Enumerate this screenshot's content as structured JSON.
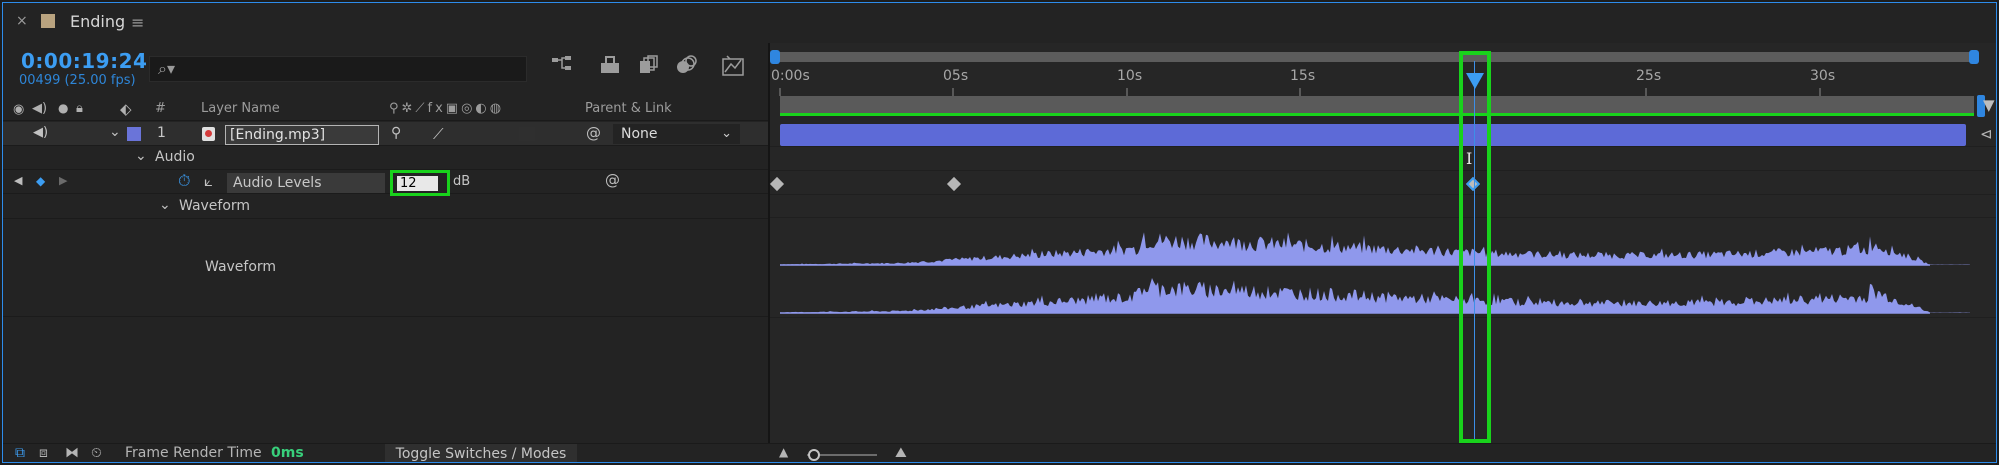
{
  "tab": {
    "close": "×",
    "title": "Ending",
    "menu": "≡"
  },
  "time": {
    "timecode": "0:00:19:24",
    "frames": "00499 (25.00 fps)"
  },
  "search": {
    "placeholder": "",
    "icon": "search-icon"
  },
  "header": {
    "layer_name": "Layer Name",
    "number": "#",
    "parent_link": "Parent & Link"
  },
  "layer": {
    "number": "1",
    "name": "[Ending.mp3]",
    "parent": "None",
    "color": "#6a74d9"
  },
  "audio_group": {
    "label": "Audio"
  },
  "audio_levels": {
    "label": "Audio Levels",
    "value": "12",
    "unit": "dB"
  },
  "waveform_group": {
    "label": "Waveform"
  },
  "waveform_row": {
    "label": "Waveform"
  },
  "ruler": {
    "labels": [
      "0:00s",
      "05s",
      "10s",
      "15s",
      "25s",
      "30s"
    ]
  },
  "footer": {
    "render_label": "Frame Render Time",
    "render_value": "0ms",
    "toggle": "Toggle Switches / Modes"
  },
  "colors": {
    "accent": "#2d8ceb",
    "highlight": "#19d21c",
    "layer_bar": "#5d6ad7",
    "waveform": "#8f98ec"
  }
}
